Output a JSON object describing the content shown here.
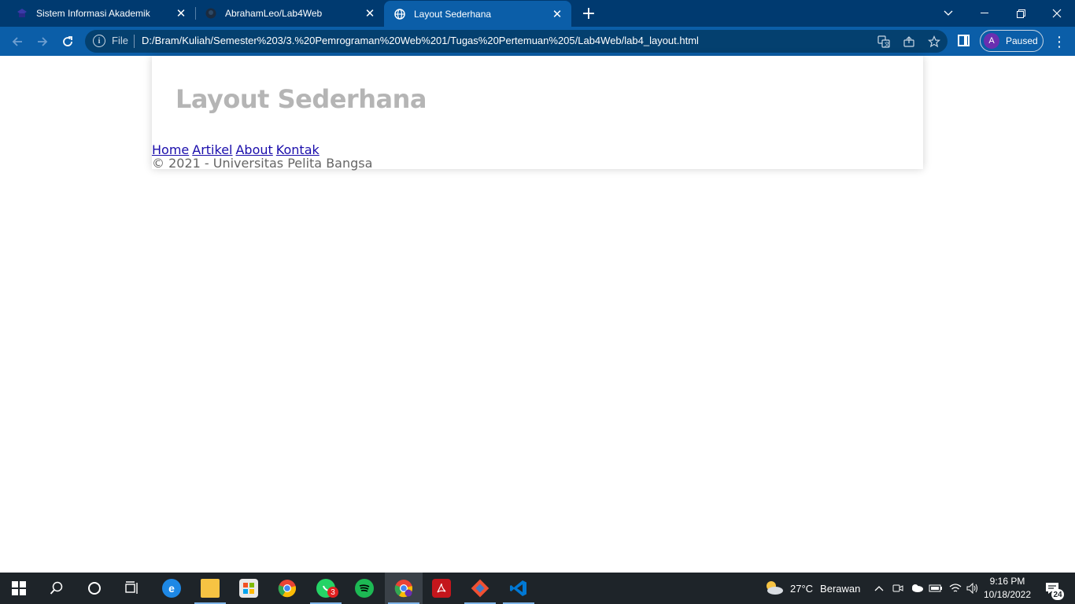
{
  "browser": {
    "tabs": [
      {
        "title": "Sistem Informasi Akademik",
        "icon": "academic-icon",
        "active": false
      },
      {
        "title": "AbrahamLeo/Lab4Web",
        "icon": "github-icon",
        "active": false
      },
      {
        "title": "Layout Sederhana",
        "icon": "globe-icon",
        "active": true
      }
    ],
    "address": {
      "scheme_label": "File",
      "url": "D:/Bram/Kuliah/Semester%203/3.%20Pemrograman%20Web%201/Tugas%20Pertemuan%205/Lab4Web/lab4_layout.html"
    },
    "profile": {
      "initial": "A",
      "status": "Paused"
    },
    "colors": {
      "tabbar": "#003a70",
      "toolbar": "#0b5ea8",
      "omnibox": "#04406f",
      "avatar": "#6a2fb0"
    }
  },
  "page": {
    "header_title": "Layout Sederhana",
    "nav": [
      "Home",
      "Artikel",
      "About",
      "Kontak"
    ],
    "footer": "© 2021 - Universitas Pelita Bangsa",
    "colors": {
      "title": "#b5b5b5",
      "link": "#1a0dab",
      "footer": "#666666"
    }
  },
  "taskbar": {
    "apps": [
      {
        "name": "edge-app",
        "icon": "edge-icon",
        "color": "#1e88e5"
      },
      {
        "name": "file-explorer-app",
        "icon": "folder-icon",
        "color": "#f6c343"
      },
      {
        "name": "microsoft-store-app",
        "icon": "store-icon",
        "color": "#e8e8e8"
      },
      {
        "name": "chrome-app",
        "icon": "chrome-icon",
        "color": "#ea4335"
      },
      {
        "name": "whatsapp-app",
        "icon": "whatsapp-icon",
        "color": "#25d366",
        "badge": "3"
      },
      {
        "name": "spotify-app",
        "icon": "spotify-icon",
        "color": "#1db954"
      },
      {
        "name": "chrome-profile-app",
        "icon": "chrome-icon",
        "color": "#ea4335"
      },
      {
        "name": "acrobat-app",
        "icon": "pdf-icon",
        "color": "#c4161c"
      },
      {
        "name": "git-app",
        "icon": "git-icon",
        "color": "#f05032"
      },
      {
        "name": "vscode-app",
        "icon": "vscode-icon",
        "color": "#0078d4"
      }
    ],
    "weather": {
      "temp": "27°C",
      "condition": "Berawan"
    },
    "time": "9:16 PM",
    "date": "10/18/2022",
    "notifications": "24"
  }
}
